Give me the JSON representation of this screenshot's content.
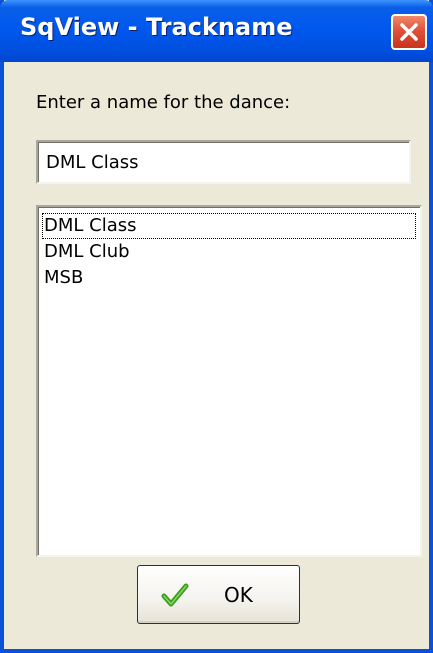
{
  "window": {
    "title": "SqView - Trackname",
    "close_icon": "close-icon"
  },
  "dialog": {
    "prompt": "Enter a name for the dance:",
    "name_value": "DML Class",
    "list_items": [
      {
        "label": "DML Class",
        "focused": true
      },
      {
        "label": "DML Club",
        "focused": false
      },
      {
        "label": "MSB",
        "focused": false
      }
    ]
  },
  "ok_button": {
    "label": "OK",
    "icon": "checkmark-icon"
  },
  "colors": {
    "titlebar": "#0058ee",
    "window_bg": "#ece9d8",
    "close_button": "#e0503a",
    "checkmark": "#3a9e1e"
  }
}
